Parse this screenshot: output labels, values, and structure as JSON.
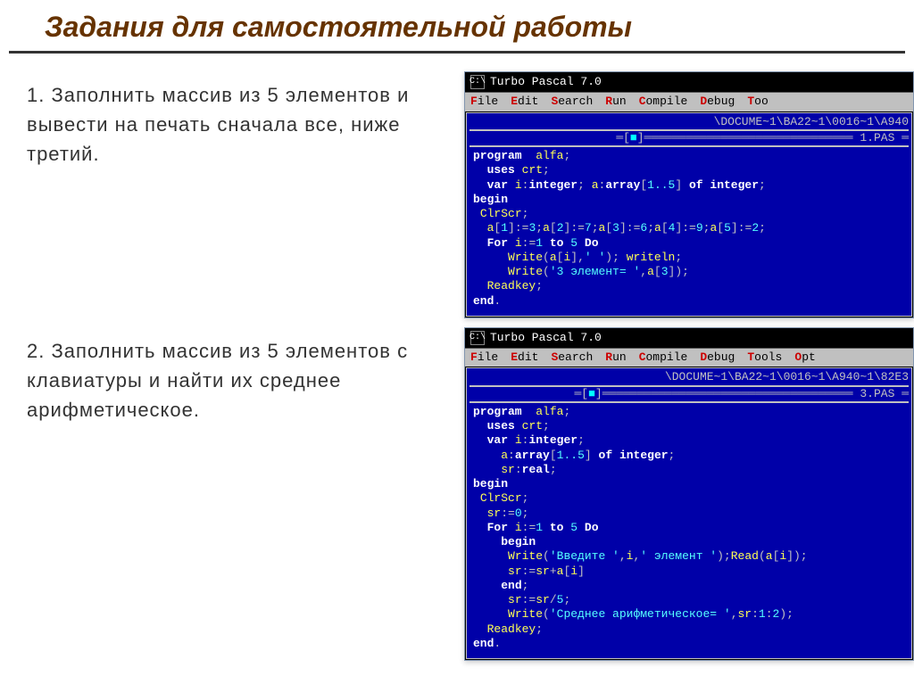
{
  "title": "Задания для самостоятельной работы",
  "tasks": [
    {
      "num": "1.",
      "text": "Заполнить массив из 5 элементов и вывести на печать сначала все, ниже третий."
    },
    {
      "num": "2.",
      "text": "Заполнить массив из 5 элементов с клавиатуры и найти их среднее арифметическое."
    }
  ],
  "windows": [
    {
      "title": "Turbo Pascal 7.0",
      "menubar": [
        "File",
        "Edit",
        "Search",
        "Run",
        "Compile",
        "Debug",
        "Too"
      ],
      "path": "\\DOCUME~1\\BA22~1\\0016~1\\A940",
      "filename": "1.PAS",
      "code_html": "<span class='kw'>program</span>  <span class='id'>alfa</span><span class='gray'>;</span>\n  <span class='kw'>uses</span> <span class='id'>crt</span><span class='gray'>;</span>\n  <span class='kw'>var</span> <span class='id'>i</span><span class='gray'>:</span><span class='kw'>integer</span><span class='gray'>;</span> <span class='id'>a</span><span class='gray'>:</span><span class='kw'>array</span><span class='gray'>[</span><span class='num'>1..5</span><span class='gray'>]</span> <span class='kw'>of</span> <span class='kw'>integer</span><span class='gray'>;</span>\n<span class='kw'>begin</span>\n <span class='id'>ClrScr</span><span class='gray'>;</span>\n  <span class='id'>a</span><span class='gray'>[</span><span class='num'>1</span><span class='gray'>]:=</span><span class='num'>3</span><span class='gray'>;</span><span class='id'>a</span><span class='gray'>[</span><span class='num'>2</span><span class='gray'>]:=</span><span class='num'>7</span><span class='gray'>;</span><span class='id'>a</span><span class='gray'>[</span><span class='num'>3</span><span class='gray'>]:=</span><span class='num'>6</span><span class='gray'>;</span><span class='id'>a</span><span class='gray'>[</span><span class='num'>4</span><span class='gray'>]:=</span><span class='num'>9</span><span class='gray'>;</span><span class='id'>a</span><span class='gray'>[</span><span class='num'>5</span><span class='gray'>]:=</span><span class='num'>2</span><span class='gray'>;</span>\n  <span class='kw'>For</span> <span class='id'>i</span><span class='gray'>:=</span><span class='num'>1</span> <span class='kw'>to</span> <span class='num'>5</span> <span class='kw'>Do</span>\n     <span class='id'>Write</span><span class='gray'>(</span><span class='id'>a</span><span class='gray'>[</span><span class='id'>i</span><span class='gray'>],</span><span class='str'>' '</span><span class='gray'>);</span> <span class='id'>writeln</span><span class='gray'>;</span>\n     <span class='id'>Write</span><span class='gray'>(</span><span class='str'>'3 элемент= '</span><span class='gray'>,</span><span class='id'>a</span><span class='gray'>[</span><span class='num'>3</span><span class='gray'>]);</span>\n  <span class='id'>Readkey</span><span class='gray'>;</span>\n<span class='kw'>end</span><span class='gray'>.</span>"
    },
    {
      "title": "Turbo Pascal 7.0",
      "menubar": [
        "File",
        "Edit",
        "Search",
        "Run",
        "Compile",
        "Debug",
        "Tools",
        "Opt"
      ],
      "path": "\\DOCUME~1\\BA22~1\\0016~1\\A940~1\\82E3",
      "filename": "3.PAS",
      "code_html": "<span class='kw'>program</span>  <span class='id'>alfa</span><span class='gray'>;</span>\n  <span class='kw'>uses</span> <span class='id'>crt</span><span class='gray'>;</span>\n  <span class='kw'>var</span> <span class='id'>i</span><span class='gray'>:</span><span class='kw'>integer</span><span class='gray'>;</span>\n    <span class='id'>a</span><span class='gray'>:</span><span class='kw'>array</span><span class='gray'>[</span><span class='num'>1..5</span><span class='gray'>]</span> <span class='kw'>of</span> <span class='kw'>integer</span><span class='gray'>;</span>\n    <span class='id'>sr</span><span class='gray'>:</span><span class='kw'>real</span><span class='gray'>;</span>\n<span class='kw'>begin</span>\n <span class='id'>ClrScr</span><span class='gray'>;</span>\n  <span class='id'>sr</span><span class='gray'>:=</span><span class='num'>0</span><span class='gray'>;</span>\n  <span class='kw'>For</span> <span class='id'>i</span><span class='gray'>:=</span><span class='num'>1</span> <span class='kw'>to</span> <span class='num'>5</span> <span class='kw'>Do</span>\n    <span class='kw'>begin</span>\n     <span class='id'>Write</span><span class='gray'>(</span><span class='str'>'Введите '</span><span class='gray'>,</span><span class='id'>i</span><span class='gray'>,</span><span class='str'>' элемент '</span><span class='gray'>);</span><span class='id'>Read</span><span class='gray'>(</span><span class='id'>a</span><span class='gray'>[</span><span class='id'>i</span><span class='gray'>]);</span>\n     <span class='id'>sr</span><span class='gray'>:=</span><span class='id'>sr</span><span class='gray'>+</span><span class='id'>a</span><span class='gray'>[</span><span class='id'>i</span><span class='gray'>]</span>\n    <span class='kw'>end</span><span class='gray'>;</span>\n     <span class='id'>sr</span><span class='gray'>:=</span><span class='id'>sr</span><span class='gray'>/</span><span class='num'>5</span><span class='gray'>;</span>\n     <span class='id'>Write</span><span class='gray'>(</span><span class='str'>'Среднее арифметическое= '</span><span class='gray'>,</span><span class='id'>sr</span><span class='gray'>:</span><span class='num'>1</span><span class='gray'>:</span><span class='num'>2</span><span class='gray'>);</span>\n  <span class='id'>Readkey</span><span class='gray'>;</span>\n<span class='kw'>end</span><span class='gray'>.</span>"
    }
  ]
}
